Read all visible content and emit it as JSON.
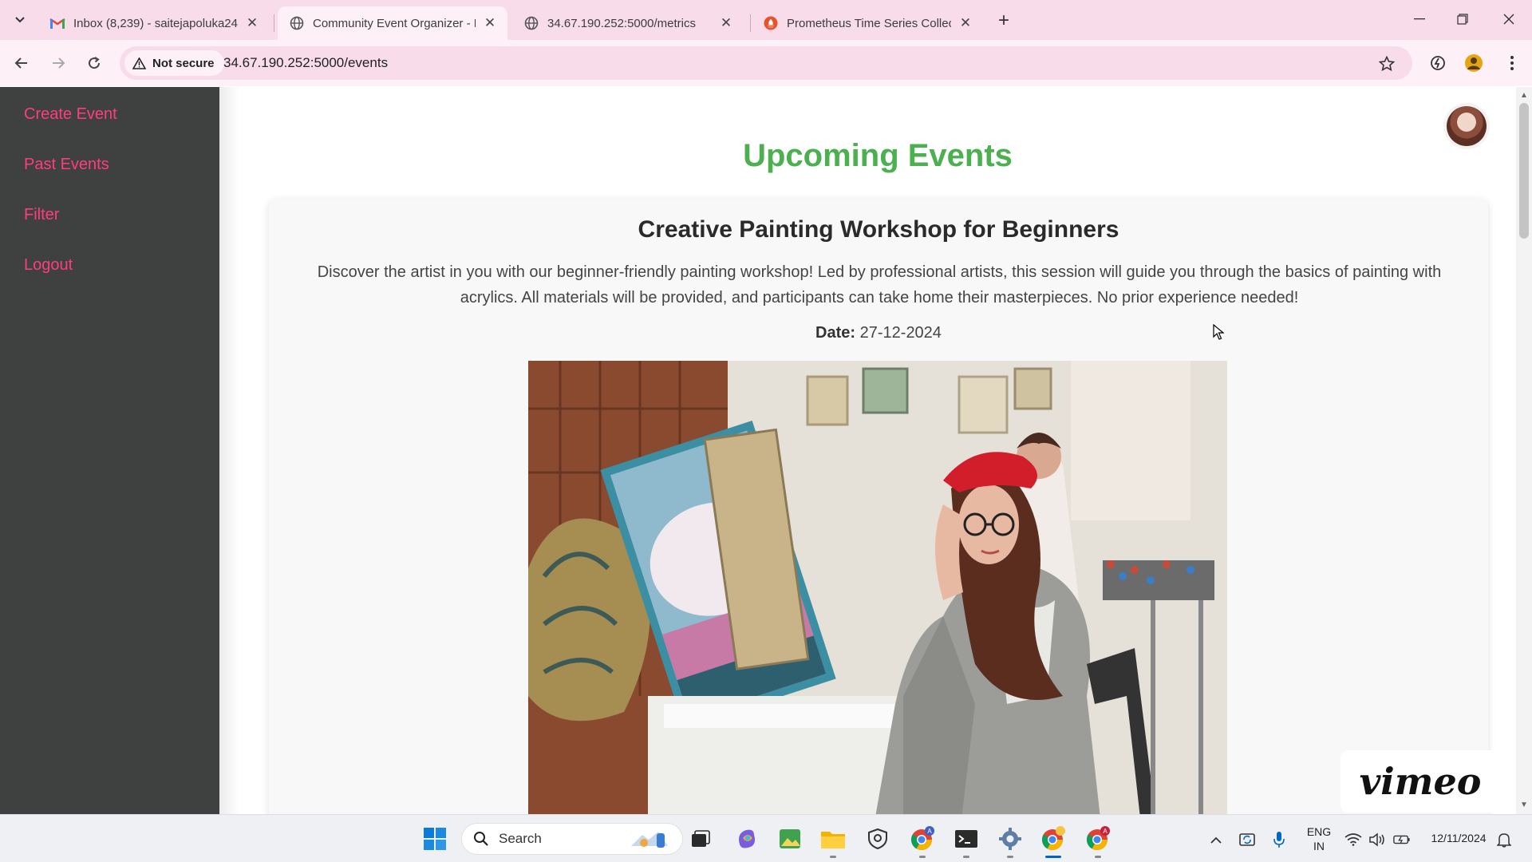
{
  "browser": {
    "tabs": [
      {
        "title": "Inbox (8,239) - saitejapoluka24",
        "icon": "gmail-icon",
        "active": false
      },
      {
        "title": "Community Event Organizer - E",
        "icon": "globe-icon",
        "active": true
      },
      {
        "title": "34.67.190.252:5000/metrics",
        "icon": "globe-icon",
        "active": false
      },
      {
        "title": "Prometheus Time Series Collect",
        "icon": "prometheus-icon",
        "active": false
      }
    ],
    "security_label": "Not secure",
    "url": "34.67.190.252:5000/events"
  },
  "sidebar": {
    "items": [
      {
        "label": "Create Event"
      },
      {
        "label": "Past Events"
      },
      {
        "label": "Filter"
      },
      {
        "label": "Logout"
      }
    ]
  },
  "main": {
    "heading": "Upcoming Events",
    "event": {
      "title": "Creative Painting Workshop for Beginners",
      "description": "Discover the artist in you with our beginner-friendly painting workshop! Led by professional artists, this session will guide you through the basics of painting with acrylics. All materials will be provided, and participants can take home their masterpieces. No prior experience needed!",
      "date_label": "Date:",
      "date_value": "27-12-2024"
    }
  },
  "watermark": "vimeo",
  "taskbar": {
    "search_placeholder": "Search",
    "lang_line1": "ENG",
    "lang_line2": "IN",
    "date": "12/11/2024"
  },
  "colors": {
    "sidebar_bg": "#3f4141",
    "sidebar_link": "#ff3d7c",
    "heading_green": "#4caf50",
    "tab_strip": "#f8dcea"
  }
}
